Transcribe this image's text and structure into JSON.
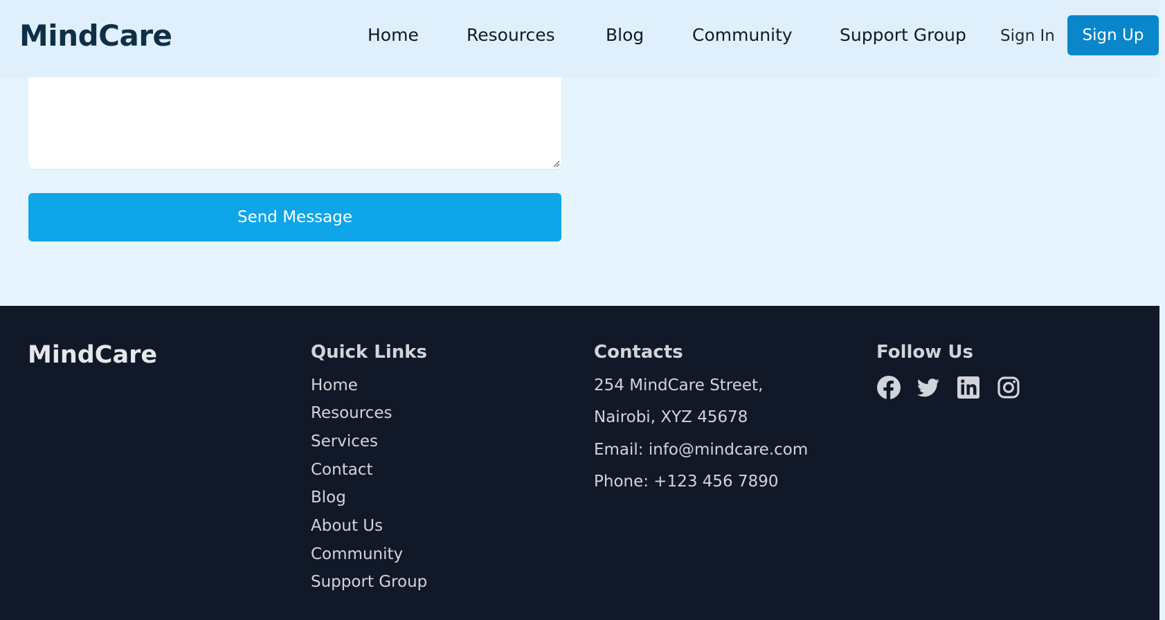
{
  "header": {
    "brand": "MindCare",
    "nav": [
      "Home",
      "Resources",
      "Blog",
      "Community",
      "Support Group"
    ],
    "sign_in": "Sign In",
    "sign_up": "Sign Up"
  },
  "form": {
    "send_label": "Send Message"
  },
  "footer": {
    "brand": "MindCare",
    "quick_links_title": "Quick Links",
    "quick_links": [
      "Home",
      "Resources",
      "Services",
      "Contact",
      "Blog",
      "About Us",
      "Community",
      "Support Group"
    ],
    "contacts_title": "Contacts",
    "contacts": [
      "254 MindCare Street,",
      "Nairobi, XYZ 45678",
      "Email: info@mindcare.com",
      "Phone: +123 456 7890"
    ],
    "follow_title": "Follow Us",
    "social": [
      "facebook-icon",
      "twitter-icon",
      "linkedin-icon",
      "instagram-icon"
    ]
  },
  "colors": {
    "page_bg": "#e6f4fd",
    "header_bg": "#dff0fc",
    "brand_text": "#0f2f46",
    "signup_bg": "#0a86cb",
    "send_bg": "#0ea5e9",
    "footer_bg": "#111827",
    "footer_text": "#d1d5db"
  }
}
